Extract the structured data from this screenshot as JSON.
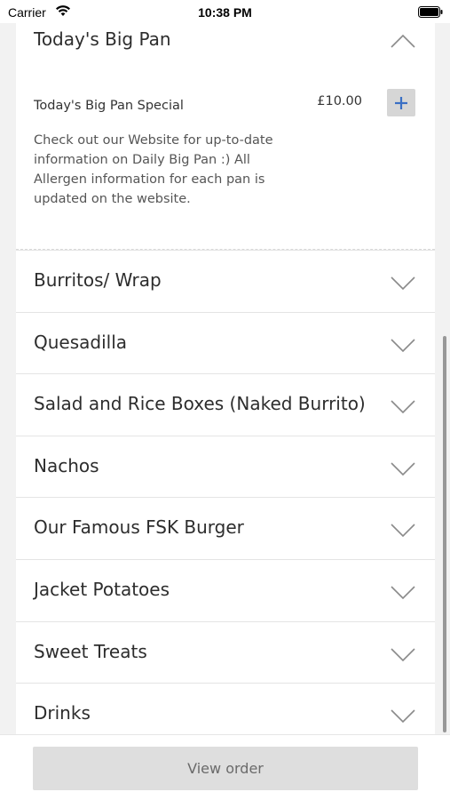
{
  "status_bar": {
    "carrier": "Carrier",
    "time": "10:38 PM"
  },
  "open_section": {
    "title": "Today's Big Pan",
    "item": {
      "name": "Today's Big Pan Special",
      "price": "£10.00",
      "description": "Check out our Website for up-to-date information on Daily Big Pan :) All Allergen information for each pan is updated on the website."
    }
  },
  "sections": [
    {
      "title": "Burritos/ Wrap"
    },
    {
      "title": "Quesadilla"
    },
    {
      "title": "Salad and Rice Boxes (Naked Burrito)"
    },
    {
      "title": "Nachos"
    },
    {
      "title": "Our Famous FSK Burger"
    },
    {
      "title": "Jacket Potatoes"
    },
    {
      "title": "Sweet Treats"
    },
    {
      "title": "Drinks"
    }
  ],
  "bottom": {
    "view_order_label": "View order"
  },
  "colors": {
    "accent": "#3a6fc4",
    "button_bg": "#dedede"
  }
}
